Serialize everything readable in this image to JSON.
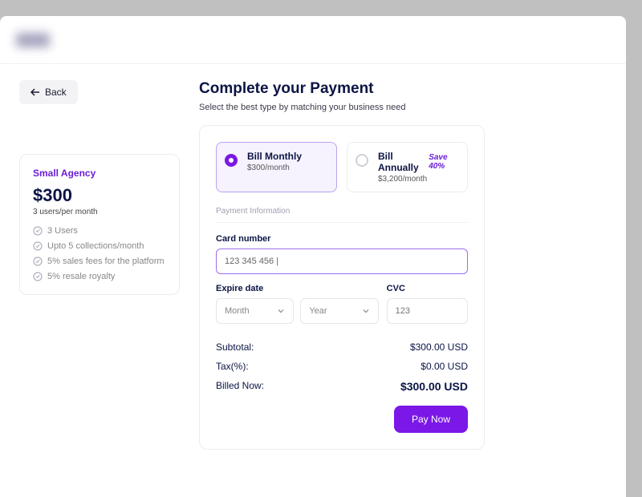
{
  "back_label": "Back",
  "header": {
    "title": "Complete your Payment",
    "subtitle": "Select the best type by matching your business need"
  },
  "plan": {
    "name": "Small Agency",
    "price": "$300",
    "unit": "3 users/per month",
    "features": [
      "3 Users",
      "Upto 5 collections/month",
      "5% sales fees for the platform",
      "5% resale royalty"
    ]
  },
  "billing": {
    "monthly": {
      "title": "Bill Monthly",
      "sub": "$300/month"
    },
    "annually": {
      "title": "Bill Annually",
      "badge": "Save 40%",
      "sub": "$3,200/month"
    }
  },
  "payment_info_label": "Payment Information",
  "card": {
    "label": "Card number",
    "value": "123 345 456 |"
  },
  "expire": {
    "label": "Expire date",
    "month": "Month",
    "year": "Year"
  },
  "cvc": {
    "label": "CVC",
    "placeholder": "123"
  },
  "totals": {
    "subtotal_label": "Subtotal:",
    "subtotal_value": "$300.00 USD",
    "tax_label": "Tax(%):",
    "tax_value": "$0.00 USD",
    "billed_label": "Billed Now:",
    "billed_value": "$300.00 USD"
  },
  "pay_button": "Pay Now"
}
